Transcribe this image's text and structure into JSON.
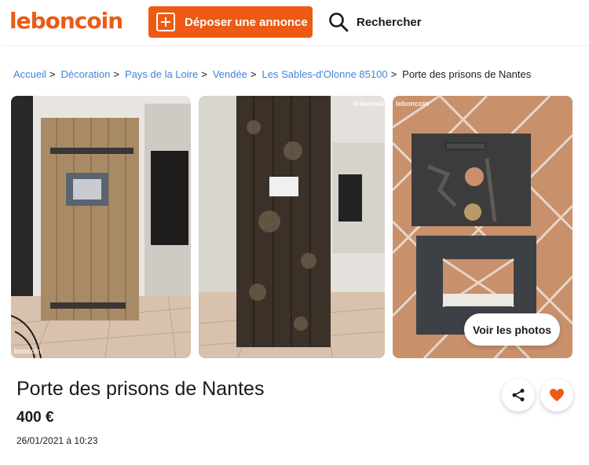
{
  "header": {
    "logo": "leboncoin",
    "post_label": "Déposer une annonce",
    "search_label": "Rechercher"
  },
  "breadcrumb": {
    "items": [
      "Accueil",
      "Décoration",
      "Pays de la Loire",
      "Vendée",
      "Les Sables-d'Olonne 85100"
    ],
    "current": "Porte des prisons de Nantes",
    "separator": ">"
  },
  "gallery": {
    "watermark": "leboncoin",
    "view_photos_label": "Voir les photos"
  },
  "listing": {
    "title": "Porte des prisons de Nantes",
    "price": "400 €",
    "date": "26/01/2021 à 10:23"
  },
  "colors": {
    "brand": "#ec5a13",
    "link": "#4183d7"
  },
  "icons": [
    "plus-square-icon",
    "search-icon",
    "share-icon",
    "heart-icon"
  ]
}
